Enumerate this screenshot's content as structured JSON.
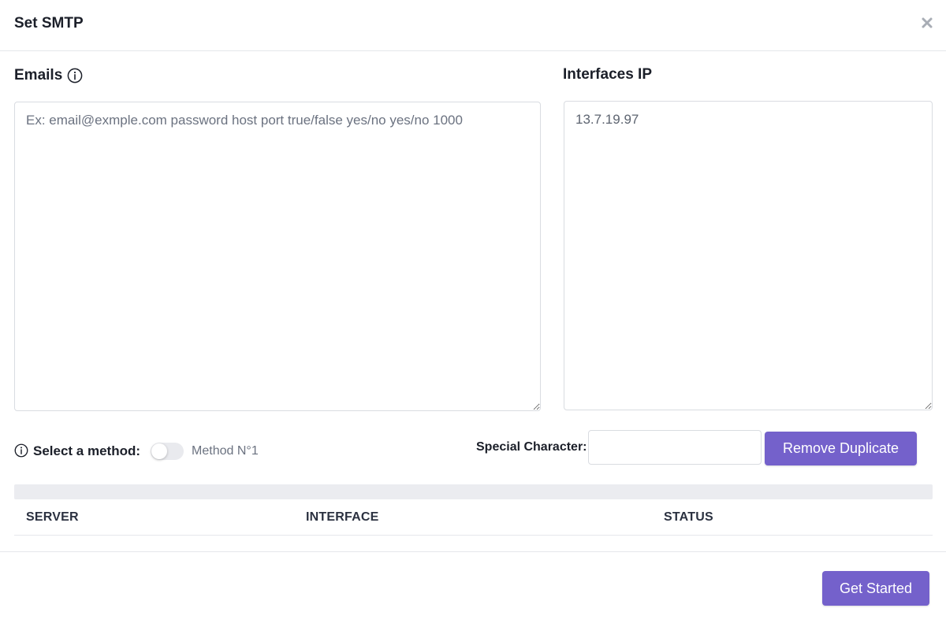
{
  "modal": {
    "title": "Set SMTP"
  },
  "emails": {
    "label": "Emails",
    "placeholder": "Ex: email@exmple.com password host port true/false yes/no yes/no 1000",
    "value": ""
  },
  "interfaces": {
    "label": "Interfaces IP",
    "value": "13.7.19.97"
  },
  "method": {
    "label": "Select a method:",
    "toggle_on": false,
    "value": "Method N°1"
  },
  "special": {
    "label": "Special Character:",
    "value": ""
  },
  "buttons": {
    "remove_duplicate": "Remove Duplicate",
    "get_started": "Get Started"
  },
  "table": {
    "columns": [
      "SERVER",
      "INTERFACE",
      "STATUS"
    ],
    "rows": []
  },
  "icons": {
    "close": "close-icon",
    "info": "info-icon"
  },
  "colors": {
    "accent": "#7461cb"
  }
}
